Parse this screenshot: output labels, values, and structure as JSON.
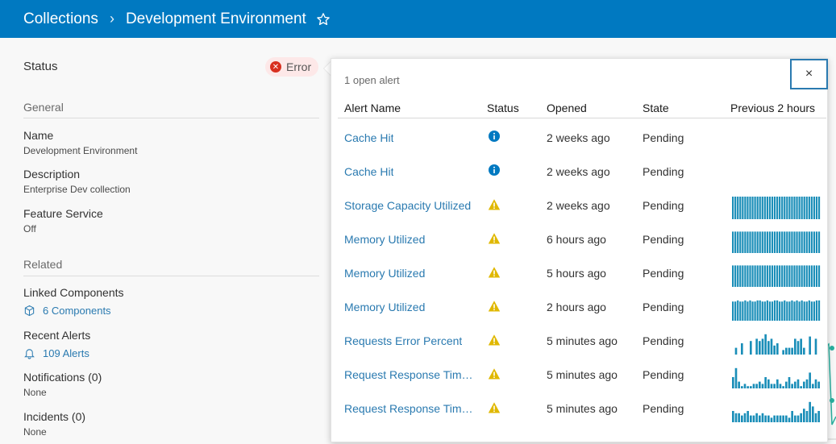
{
  "header": {
    "breadcrumb_root": "Collections",
    "breadcrumb_current": "Development Environment",
    "favorite_icon": "star-outline-icon"
  },
  "left_panel": {
    "status_label": "Status",
    "status_badge": "Error",
    "general_heading": "General",
    "name_label": "Name",
    "name_value": "Development Environment",
    "description_label": "Description",
    "description_value": "Enterprise Dev collection",
    "feature_service_label": "Feature Service",
    "feature_service_value": "Off",
    "related_heading": "Related",
    "linked_components_label": "Linked Components",
    "linked_components_link": "6 Components",
    "recent_alerts_label": "Recent Alerts",
    "recent_alerts_link": "109 Alerts",
    "notifications_label": "Notifications (0)",
    "notifications_value": "None",
    "incidents_label": "Incidents (0)",
    "incidents_value": "None"
  },
  "popover": {
    "open_count": "1 open alert",
    "close_label": "×",
    "columns": [
      "Alert Name",
      "Status",
      "Opened",
      "State",
      "Previous 2 hours"
    ],
    "rows": [
      {
        "name": "Cache Hit",
        "status": "info",
        "opened": "2 weeks ago",
        "state": "Pending",
        "spark": []
      },
      {
        "name": "Cache Hit",
        "status": "info",
        "opened": "2 weeks ago",
        "state": "Pending",
        "spark": []
      },
      {
        "name": "Storage Capacity Utilized",
        "status": "warning",
        "opened": "2 weeks ago",
        "state": "Pending",
        "spark": [
          1,
          1,
          1,
          1,
          1,
          1,
          1,
          1,
          1,
          1,
          1,
          1,
          1,
          1,
          1,
          1,
          1,
          1,
          1,
          1,
          1,
          1,
          1,
          1,
          1,
          1,
          1,
          1,
          1,
          1,
          1,
          1,
          1,
          1,
          1,
          1
        ]
      },
      {
        "name": "Memory Utilized",
        "status": "warning",
        "opened": "6 hours ago",
        "state": "Pending",
        "spark": [
          0.95,
          0.95,
          0.95,
          0.95,
          0.95,
          0.95,
          0.95,
          0.95,
          0.95,
          0.95,
          0.95,
          0.95,
          0.95,
          0.95,
          0.95,
          0.95,
          0.95,
          0.95,
          0.95,
          0.95,
          0.95,
          0.95,
          0.95,
          0.95,
          0.95,
          0.95,
          0.95,
          0.95,
          0.95,
          0.95,
          0.95,
          0.95,
          0.95,
          0.95,
          0.95,
          0.95
        ]
      },
      {
        "name": "Memory Utilized",
        "status": "warning",
        "opened": "5 hours ago",
        "state": "Pending",
        "spark": [
          0.95,
          0.95,
          0.95,
          0.95,
          0.95,
          0.95,
          0.95,
          0.95,
          0.95,
          0.95,
          0.95,
          0.95,
          0.95,
          0.95,
          0.95,
          0.95,
          0.95,
          0.95,
          0.95,
          0.95,
          0.95,
          0.95,
          0.95,
          0.95,
          0.95,
          0.95,
          0.95,
          0.95,
          0.95,
          0.95,
          0.95,
          0.95,
          0.95,
          0.95,
          0.95,
          0.95
        ]
      },
      {
        "name": "Memory Utilized",
        "status": "warning",
        "opened": "2 hours ago",
        "state": "Pending",
        "spark": [
          0.85,
          0.85,
          0.9,
          0.85,
          0.85,
          0.9,
          0.85,
          0.9,
          0.85,
          0.85,
          0.9,
          0.9,
          0.85,
          0.85,
          0.9,
          0.85,
          0.85,
          0.9,
          0.9,
          0.85,
          0.85,
          0.9,
          0.85,
          0.85,
          0.9,
          0.85,
          0.9,
          0.85,
          0.9,
          0.85,
          0.85,
          0.9,
          0.85,
          0.85,
          0.9,
          0.9
        ]
      },
      {
        "name": "Requests Error Percent",
        "status": "warning",
        "opened": "5 minutes ago",
        "state": "Pending",
        "spark": [
          0,
          0.3,
          0,
          0.5,
          0,
          0,
          0.6,
          0,
          0.7,
          0.6,
          0.7,
          0.9,
          0.6,
          0.7,
          0.4,
          0.5,
          0,
          0.2,
          0.3,
          0.3,
          0.3,
          0.7,
          0.6,
          0.7,
          0.3,
          0,
          0.8,
          0,
          0.7,
          0
        ]
      },
      {
        "name": "Request Response Tim…",
        "status": "warning",
        "opened": "5 minutes ago",
        "state": "Pending",
        "spark": [
          0.5,
          0.9,
          0.3,
          0.1,
          0.2,
          0.1,
          0.1,
          0.2,
          0.2,
          0.3,
          0.2,
          0.5,
          0.4,
          0.2,
          0.2,
          0.4,
          0.2,
          0.1,
          0.3,
          0.5,
          0.2,
          0.3,
          0.4,
          0.1,
          0.3,
          0.4,
          0.7,
          0.2,
          0.4,
          0.3
        ]
      },
      {
        "name": "Request Response Tim…",
        "status": "warning",
        "opened": "5 minutes ago",
        "state": "Pending",
        "spark": [
          0.5,
          0.4,
          0.4,
          0.3,
          0.4,
          0.5,
          0.3,
          0.3,
          0.4,
          0.3,
          0.4,
          0.3,
          0.3,
          0.2,
          0.3,
          0.3,
          0.3,
          0.3,
          0.3,
          0.2,
          0.5,
          0.3,
          0.3,
          0.4,
          0.6,
          0.5,
          0.9,
          0.7,
          0.4,
          0.5
        ]
      }
    ]
  },
  "colors": {
    "brand": "#0079c1",
    "link": "#2a7ab0",
    "error": "#d83020",
    "warning": "#e0b800",
    "info": "#0079c1",
    "spark": "#1a8eb8"
  }
}
